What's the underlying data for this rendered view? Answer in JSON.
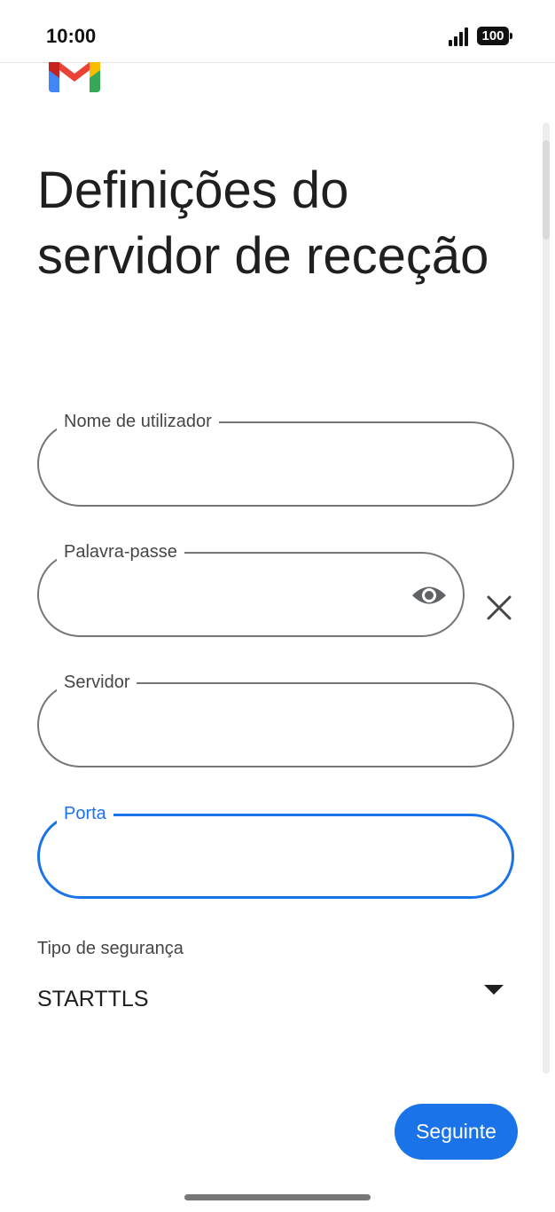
{
  "status": {
    "time": "10:00",
    "battery": "100"
  },
  "header": {
    "logo_icon": "gmail-logo-icon"
  },
  "title": "Definições do servidor de receção",
  "fields": {
    "username": {
      "label": "Nome de utilizador",
      "value": ""
    },
    "password": {
      "label": "Palavra-passe",
      "value": "",
      "toggle_icon": "eye-icon",
      "clear_icon": "close-icon"
    },
    "server": {
      "label": "Servidor",
      "value": ""
    },
    "port": {
      "label": "Porta",
      "value": "",
      "focused": true
    }
  },
  "security": {
    "label": "Tipo de segurança",
    "value": "STARTTLS",
    "arrow_icon": "triangle-down-icon"
  },
  "actions": {
    "next_label": "Seguinte"
  },
  "colors": {
    "accent": "#1a73e8",
    "outline": "#747775",
    "text": "#1f1f1f"
  }
}
